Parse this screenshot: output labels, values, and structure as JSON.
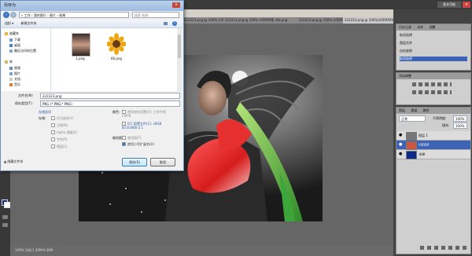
{
  "app": {
    "title": "",
    "menu": [],
    "doc_tabs": [
      "222223.png @ 100% (VSRRP...",
      "222223.png @ 100% (VSRRP图层1, RGB/8)",
      "dfa.png",
      "222223.png @ 100% (VSRRP/RGB/8) *",
      "222223.png @ 100%(VSRRP/RGB/8) *"
    ],
    "workspace": "基本功能",
    "status": "100%  文档:1.20M/4.46M"
  },
  "history_panel": {
    "tabs": [
      "历史记录",
      "动作",
      "调整"
    ],
    "items": [
      "取消选择",
      "图层合并",
      "自由变换",
      "取消选择"
    ]
  },
  "adjust_panel": {
    "title": "添加调整"
  },
  "layers_panel": {
    "tabs": [
      "图层",
      "通道",
      "路径"
    ],
    "blend_mode": "正常",
    "opacity_label": "不透明度:",
    "opacity": "100%",
    "fill_label": "填充:",
    "fill": "100%",
    "layers": [
      {
        "name": "图层 1"
      },
      {
        "name": "VSRRP"
      },
      {
        "name": "背景"
      }
    ]
  },
  "dialog": {
    "title": "另存为",
    "breadcrumb": "« 工作 › 我的图片 › 图片 › 效果",
    "search_placeholder": "搜索 效果",
    "toolbar": {
      "organize": "组织 ▾",
      "new_folder": "新建文件夹"
    },
    "nav": {
      "favorites": "收藏夹",
      "fav_items": [
        "下载",
        "桌面",
        "最近访问的位置"
      ],
      "library": "库",
      "lib_items": [
        "视频",
        "图片",
        "文档",
        "音乐"
      ]
    },
    "files": [
      "1.png",
      "66.png"
    ],
    "filename_label": "文件名(N):",
    "filename": "222223.png",
    "filetype_label": "保存类型(T):",
    "filetype": "PNG (*.PNG;*.PNG)",
    "options_title": "存储选项",
    "store_label": "存储:",
    "store_opts": [
      "作为副本(Y)",
      "注释(N)",
      "Alpha 通道(E)",
      "专色(P)",
      "图层(L)"
    ],
    "color_label": "颜色:",
    "color_opts": [
      "使用校样设置(O): 工作中的 CMYK",
      "ICC 配置文件(C): sRGB IEC61966-2.1"
    ],
    "thumb_label": "缩览图(T)",
    "lower_case": "使用小写扩展名(U)",
    "hide_folders": "隐藏文件夹",
    "save_btn": "保存(S)",
    "cancel_btn": "取消"
  },
  "colors": {
    "selection": "#3d63b5",
    "dialog_border": "#6b8fb8"
  }
}
